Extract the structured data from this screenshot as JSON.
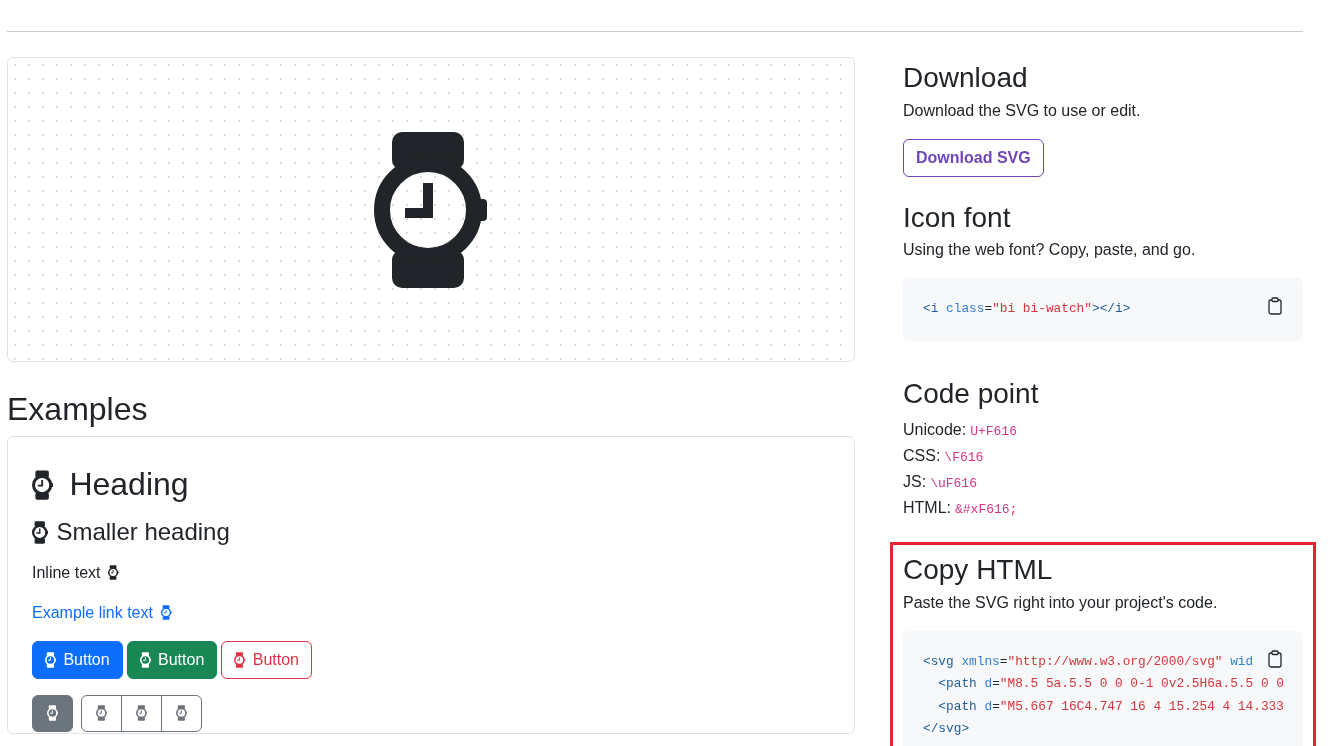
{
  "examples": {
    "title": "Examples",
    "heading": "Heading",
    "smaller_heading": "Smaller heading",
    "inline_text": "Inline text",
    "link_text": "Example link text",
    "buttons": [
      {
        "label": "Button",
        "kind": "primary"
      },
      {
        "label": "Button",
        "kind": "success"
      },
      {
        "label": "Button",
        "kind": "outline-danger"
      }
    ],
    "icon_button_groups": [
      {
        "buttons": [
          {
            "selected": true
          }
        ]
      },
      {
        "buttons": [
          {
            "selected": false
          },
          {
            "selected": false
          },
          {
            "selected": false
          }
        ]
      }
    ]
  },
  "download": {
    "title": "Download",
    "text": "Download the SVG to use or edit.",
    "button": "Download SVG"
  },
  "icon_font": {
    "title": "Icon font",
    "text": "Using the web font? Copy, paste, and go.",
    "code": [
      [
        {
          "text": "<i",
          "kind": "tag"
        },
        {
          "text": " class",
          "kind": "attr"
        },
        {
          "text": "=",
          "kind": "punct"
        },
        {
          "text": "\"bi bi-watch\"",
          "kind": "string"
        },
        {
          "text": "></i>",
          "kind": "tag"
        }
      ]
    ]
  },
  "code_point": {
    "title": "Code point",
    "rows": [
      {
        "label": "Unicode:",
        "value": "U+F616"
      },
      {
        "label": "CSS:",
        "value": "\\F616"
      },
      {
        "label": "JS:",
        "value": "\\uF616"
      },
      {
        "label": "HTML:",
        "value": "&#xF616;"
      }
    ]
  },
  "copy_html": {
    "title": "Copy HTML",
    "text": "Paste the SVG right into your project's code.",
    "highlighted": true,
    "code": [
      [
        {
          "text": "<svg",
          "kind": "tag"
        },
        {
          "text": " xmlns",
          "kind": "attr"
        },
        {
          "text": "=",
          "kind": "punct"
        },
        {
          "text": "\"http://www.w3.org/2000/svg\"",
          "kind": "string"
        },
        {
          "text": " wid",
          "kind": "attr"
        }
      ],
      [
        {
          "text": "  <path",
          "kind": "tag"
        },
        {
          "text": " d",
          "kind": "attr"
        },
        {
          "text": "=",
          "kind": "punct"
        },
        {
          "text": "\"M8.5 5a.5.5 0 0 0-1 0v2.5H6a.5.5 0 0",
          "kind": "string"
        }
      ],
      [
        {
          "text": "  <path",
          "kind": "tag"
        },
        {
          "text": " d",
          "kind": "attr"
        },
        {
          "text": "=",
          "kind": "punct"
        },
        {
          "text": "\"M5.667 16C4.747 16 4 15.254 4 14.333",
          "kind": "string"
        }
      ],
      [
        {
          "text": "</svg>",
          "kind": "tag"
        }
      ]
    ]
  }
}
